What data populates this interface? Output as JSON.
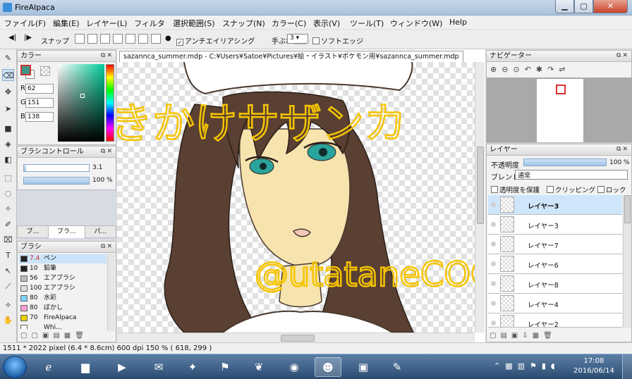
{
  "window": {
    "title": "FireAlpaca",
    "min_label": "▁",
    "max_label": "▢",
    "close_label": "✕"
  },
  "menu": [
    "ファイル(F)",
    "編集(E)",
    "レイヤー(L)",
    "フィルタ",
    "選択範囲(S)",
    "スナップ(N)",
    "カラー(C)",
    "表示(V)",
    "ツール(T)",
    "ウィンドウ(W)",
    "Help"
  ],
  "toolbar": {
    "snap_label": "スナップ",
    "antialias_label": "アンチエイリアシング",
    "antialias_checked": true,
    "stabilizer_label": "手ぶれ補正",
    "stabilizer_value": "3",
    "soft_edge_label": "ソフトエッジ",
    "soft_edge_checked": false
  },
  "color_panel": {
    "title": "カラー",
    "r_label": "R",
    "g_label": "G",
    "b_label": "B",
    "r": "62",
    "g": "151",
    "b": "138",
    "fg_color": "#3e978a"
  },
  "brush_control": {
    "title": "ブラシコントロール",
    "size_value": "3.1",
    "opacity_value": "100 %",
    "size_fraction": 0.03,
    "opacity_fraction": 1.0
  },
  "brush_tabs": [
    "ブ…",
    "ブラ…",
    "パ…"
  ],
  "brush_panel": {
    "title": "ブラシ",
    "items": [
      {
        "size": "7.4",
        "name": "ペン",
        "color": "#222222",
        "selected": true
      },
      {
        "size": "10",
        "name": "鉛筆",
        "color": "#222222",
        "selected": false
      },
      {
        "size": "56",
        "name": "エアブラシ",
        "color": "#bbbbbb",
        "selected": false
      },
      {
        "size": "100",
        "name": "エアブラシ",
        "color": "#dddddd",
        "selected": false
      },
      {
        "size": "80",
        "name": "水彩",
        "color": "#7fd3ff",
        "selected": false
      },
      {
        "size": "80",
        "name": "ぼかし",
        "color": "#ff9ed6",
        "selected": false
      },
      {
        "size": "70",
        "name": "FireAlpaca",
        "color": "#e6d000",
        "selected": false
      },
      {
        "size": "",
        "name": "Whi…",
        "color": "#ffffff",
        "selected": false
      }
    ]
  },
  "document": {
    "tab_label": "sazannca_summer.mdp - C:¥Users¥Satoe¥Pictures¥絵・イラスト¥ポケモン用¥sazannca_summer.mdp",
    "overlay_text_1": "描きかけサザンカ",
    "overlay_text_2": "@utataneCOCO",
    "overlay_color": "#f5c400",
    "line_color": "#4a3a30",
    "hair_color": "#5a4032",
    "skin_color": "#f6e3ae",
    "eye_color": "#2aa39c"
  },
  "navigator": {
    "title": "ナビゲーター"
  },
  "layer_panel": {
    "title": "レイヤー",
    "opacity_label": "不透明度",
    "opacity_value": "100 %",
    "opacity_fraction": 1.0,
    "blend_label": "ブレンド",
    "blend_value": "通常",
    "protect_label": "透明度を保護",
    "clipping_label": "クリッピング",
    "lock_label": "ロック",
    "layers": [
      {
        "name": "レイヤー3",
        "selected": true
      },
      {
        "name": "レイヤー3",
        "selected": false
      },
      {
        "name": "レイヤー7",
        "selected": false
      },
      {
        "name": "レイヤー6",
        "selected": false
      },
      {
        "name": "レイヤー8",
        "selected": false
      },
      {
        "name": "レイヤー4",
        "selected": false
      },
      {
        "name": "レイヤー2",
        "selected": false
      }
    ]
  },
  "status_bar": {
    "text": "1511 * 2022 pixel  (6.4 * 8.6cm)  600 dpi   150 %   ( 618, 299 )"
  },
  "taskbar": {
    "time": "17:08",
    "date": "2016/06/14"
  }
}
